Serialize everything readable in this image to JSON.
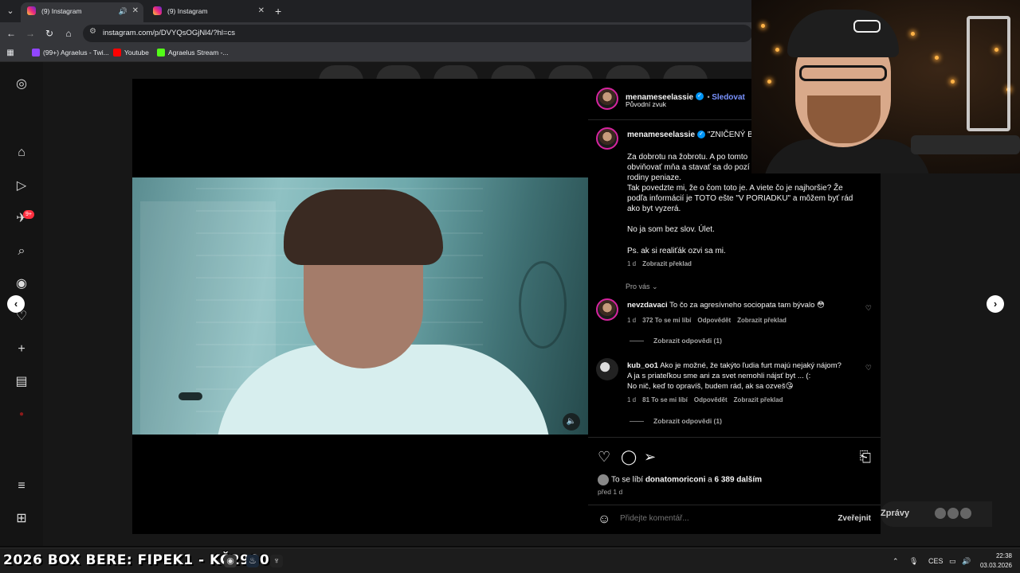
{
  "browser": {
    "tabs": [
      {
        "title": "(9) Instagram",
        "active": true
      },
      {
        "title": "(9) Instagram",
        "active": false
      }
    ],
    "url": "instagram.com/p/DVYQsOGjNl4/?hl=cs",
    "bookmarks": [
      {
        "label": "(99+) Agraelus - Twi...",
        "icon": "twitch-icon",
        "color": "#9146ff"
      },
      {
        "label": "Youtube",
        "icon": "youtube-icon",
        "color": "#ff0000"
      },
      {
        "label": "Agraelus Stream -...",
        "icon": "kick-icon",
        "color": "#53fc18"
      }
    ]
  },
  "sidebar": {
    "notification_badge": "9+"
  },
  "post": {
    "author": {
      "username": "menameseelassie",
      "follow_label": "Sledovat",
      "audio_label": "Původní zvuk"
    },
    "caption": {
      "username": "menameseelassie",
      "title_prefix": "\"ZNIČENÝ BYT\"",
      "lines": [
        "Za dobrotu na žobrotu. A po tomto",
        "obviňovať mňa a stavať sa do pozí",
        "rodiny peniaze.",
        "Tak povedzte mi, že o čom toto je. A viete čo je najhoršie? Že",
        "podľa informácií je TOTO ešte \"V PORIADKU\" a môžem byť rád",
        "ako byt vyzerá."
      ],
      "line2": "No ja som bez slov. Úlet.",
      "line3": "Ps. ak si realiťák ozvi sa mi.",
      "time": "1 d",
      "translate": "Zobrazit překlad"
    },
    "for_you_label": "Pro vás",
    "comments": [
      {
        "username": "nevzdavaci",
        "text": "To čo za agresívneho sociopata tam bývalo 😳",
        "time": "1 d",
        "likes": "372 To se mi líbí",
        "reply": "Odpovědět",
        "translate": "Zobrazit překlad",
        "replies": "Zobrazit odpovědi (1)"
      },
      {
        "username": "kub_oo1",
        "text": "Ako je možné, že takýto ľudia furt majú nejaký nájom?",
        "text2": "A ja s priateľkou sme ani za svet nemohli nájsť byt ... (:",
        "text3": "No nič, keď to opravíš, budem rád, ak sa ozveš😘",
        "time": "1 d",
        "likes": "81 To se mi líbí",
        "reply": "Odpovědět",
        "translate": "Zobrazit překlad",
        "replies": "Zobrazit odpovědi (1)"
      }
    ],
    "likes_prefix": "To se líbí",
    "likes_user": "donatomoriconi",
    "likes_mid": "a",
    "likes_count": "6 389 dalším",
    "posted": "před 1 d",
    "comment_placeholder": "Přidejte komentář...",
    "post_button": "Zveřejnit"
  },
  "messages_label": "Zprávy",
  "taskbar": {
    "ticker": "2026 BOX BERE: FIPEK1 - KČ2900",
    "language": "CES",
    "time": "22:38",
    "date": "03.03.2026"
  }
}
